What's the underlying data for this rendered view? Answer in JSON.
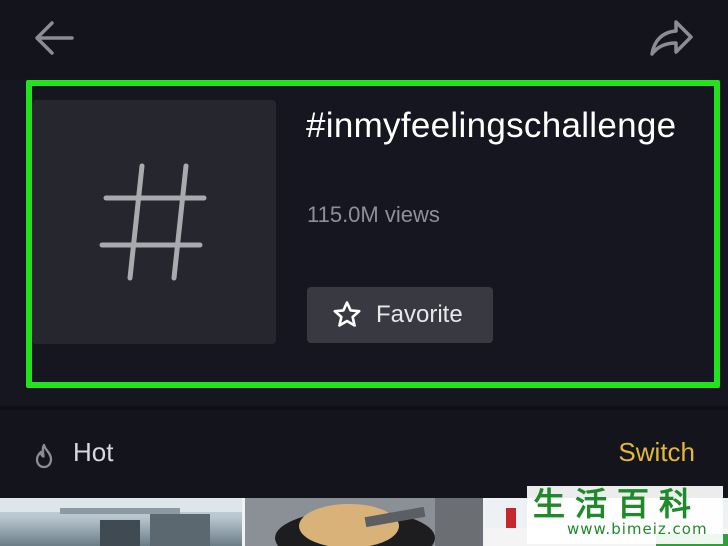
{
  "header": {
    "back_icon": "arrow-left-icon",
    "share_icon": "share-arrow-icon"
  },
  "hashtag": {
    "thumbnail_icon": "hashtag-icon",
    "title": "#inmyfeelingschallenge",
    "views": "115.0M views",
    "favorite_icon": "star-outline-icon",
    "favorite_label": "Favorite"
  },
  "tabs": {
    "hot_icon": "flame-icon",
    "hot_label": "Hot",
    "switch_label": "Switch"
  },
  "watermark": {
    "chinese": "生活百科",
    "url": "www.bimeiz.com"
  },
  "colors": {
    "highlight": "#22e31d",
    "background": "#161620",
    "button": "#383941",
    "switch": "#e3b73a",
    "watermark": "#1e8a2a"
  }
}
